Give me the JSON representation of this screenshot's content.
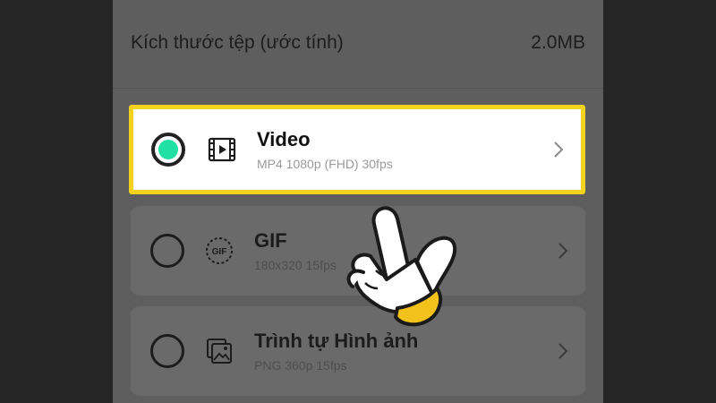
{
  "file_size": {
    "label": "Kích thước tệp (ước tính)",
    "value": "2.0MB"
  },
  "options": [
    {
      "title": "Video",
      "subtitle": "MP4 1080p (FHD) 30fps",
      "selected": true,
      "icon": "video-icon"
    },
    {
      "title": "GIF",
      "subtitle": "180x320 15fps",
      "selected": false,
      "icon": "gif-icon",
      "icon_text": "GIF"
    },
    {
      "title": "Trình tự Hình ảnh",
      "subtitle": "PNG 360p 15fps",
      "selected": false,
      "icon": "image-sequence-icon"
    }
  ],
  "colors": {
    "highlight_border": "#f5d21b",
    "radio_selected": "#20e0a3"
  }
}
